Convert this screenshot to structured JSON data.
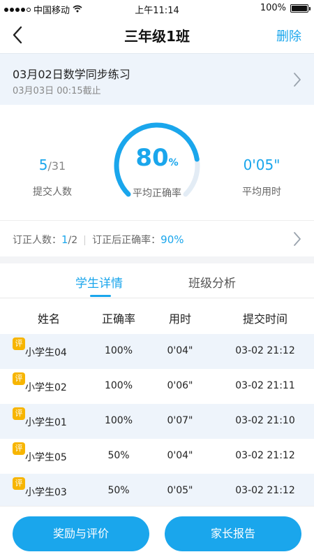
{
  "status": {
    "carrier": "中国移动",
    "time": "上午11:14",
    "battery": "100%",
    "battery_level": 1.0
  },
  "nav": {
    "title": "三年级1班",
    "action": "删除"
  },
  "task": {
    "title": "03月02日数学同步练习",
    "deadline": "03月03日 00:15截止"
  },
  "stats": {
    "submitted": "5",
    "total": "/31",
    "submitted_label": "提交人数",
    "accuracy_value": "80",
    "accuracy_unit": "%",
    "accuracy_fraction": 0.8,
    "accuracy_label": "平均正确率",
    "avg_time": "0'05\"",
    "avg_time_label": "平均用时"
  },
  "correction": {
    "count_label": "订正人数：",
    "count_value": "1",
    "count_total": "/2",
    "rate_label": "订正后正确率：",
    "rate_value": "90%"
  },
  "tabs": {
    "active": "学生详情",
    "inactive": "班级分析"
  },
  "table": {
    "headers": [
      "姓名",
      "正确率",
      "用时",
      "提交时间"
    ],
    "badge": "评",
    "rows": [
      {
        "name": "小学生04",
        "rate": "100%",
        "time": "0'04\"",
        "submitted": "03-02 21:12"
      },
      {
        "name": "小学生02",
        "rate": "100%",
        "time": "0'06\"",
        "submitted": "03-02 21:11"
      },
      {
        "name": "小学生01",
        "rate": "100%",
        "time": "0'07\"",
        "submitted": "03-02 21:10"
      },
      {
        "name": "小学生05",
        "rate": "50%",
        "time": "0'04\"",
        "submitted": "03-02 21:12"
      },
      {
        "name": "小学生03",
        "rate": "50%",
        "time": "0'05\"",
        "submitted": "03-02 21:12"
      }
    ]
  },
  "buttons": {
    "reward": "奖励与评价",
    "report": "家长报告"
  },
  "colors": {
    "accent": "#1aa6ec",
    "badge": "#f7b500",
    "row_alt": "#eef4fb"
  }
}
